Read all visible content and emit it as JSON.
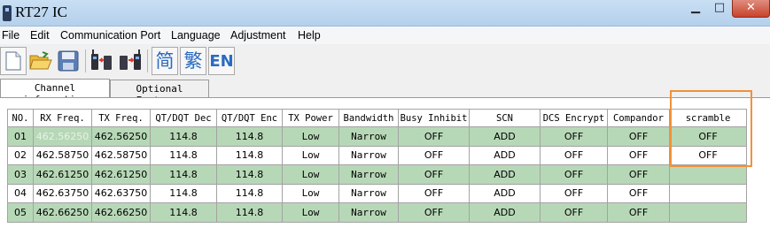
{
  "window": {
    "title": "RT27 IC",
    "min_glyph": "▁",
    "max_glyph": "□",
    "close_glyph": "✕"
  },
  "menu": [
    "File",
    "Edit",
    "Communication Port",
    "Language",
    "Adjustment",
    "Help"
  ],
  "toolbar": {
    "simplified_label": "简",
    "traditional_label": "繁",
    "english_label": "EN"
  },
  "tabs": [
    "Channel information",
    "Optional Features"
  ],
  "table": {
    "columns": [
      "NO.",
      "RX Freq.",
      "TX Freq.",
      "QT/DQT Dec",
      "QT/DQT Enc",
      "TX Power",
      "Bandwidth",
      "Busy Inhibit",
      "SCN",
      "DCS Encrypt",
      "Compandor",
      "scramble"
    ],
    "rows": [
      [
        "01",
        "462.56250",
        "462.56250",
        "114.8",
        "114.8",
        "Low",
        "Narrow",
        "OFF",
        "ADD",
        "OFF",
        "OFF",
        "OFF"
      ],
      [
        "02",
        "462.58750",
        "462.58750",
        "114.8",
        "114.8",
        "Low",
        "Narrow",
        "OFF",
        "ADD",
        "OFF",
        "OFF",
        "OFF"
      ],
      [
        "03",
        "462.61250",
        "462.61250",
        "114.8",
        "114.8",
        "Low",
        "Narrow",
        "OFF",
        "ADD",
        "OFF",
        "OFF",
        ""
      ],
      [
        "04",
        "462.63750",
        "462.63750",
        "114.8",
        "114.8",
        "Low",
        "Narrow",
        "OFF",
        "ADD",
        "OFF",
        "OFF",
        ""
      ],
      [
        "05",
        "462.66250",
        "462.66250",
        "114.8",
        "114.8",
        "Low",
        "Narrow",
        "OFF",
        "ADD",
        "OFF",
        "OFF",
        ""
      ]
    ]
  },
  "colors": {
    "row_green": "#b7d8b7",
    "highlight": "#f0913a"
  }
}
